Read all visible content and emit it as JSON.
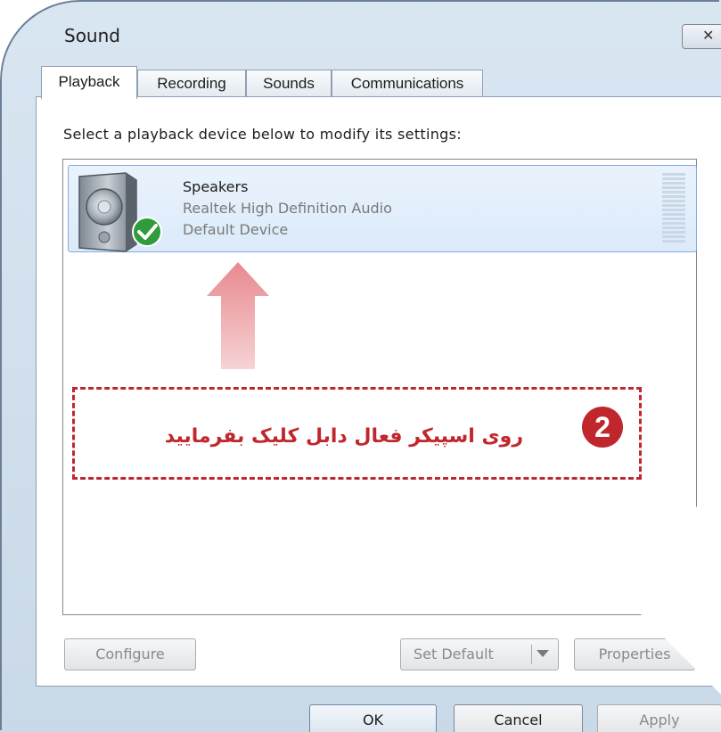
{
  "window": {
    "title": "Sound",
    "close_glyph": "✕"
  },
  "tabs": [
    {
      "label": "Playback",
      "active": true
    },
    {
      "label": "Recording",
      "active": false
    },
    {
      "label": "Sounds",
      "active": false
    },
    {
      "label": "Communications",
      "active": false
    }
  ],
  "instruction": "Select a playback device below to modify its settings:",
  "device": {
    "name": "Speakers",
    "driver": "Realtek High Definition Audio",
    "status": "Default Device",
    "icon": "speaker-icon",
    "badge_icon": "check-icon"
  },
  "annotation": {
    "text": "روی اسپیکر فعال دابل کلیک بفرمایید",
    "step_number": "2",
    "color": "#c0272d",
    "arrow_color": "#e8a0a4"
  },
  "buttons": {
    "configure": "Configure",
    "set_default": "Set Default",
    "properties": "Properties",
    "ok": "OK",
    "cancel": "Cancel",
    "apply": "Apply"
  }
}
